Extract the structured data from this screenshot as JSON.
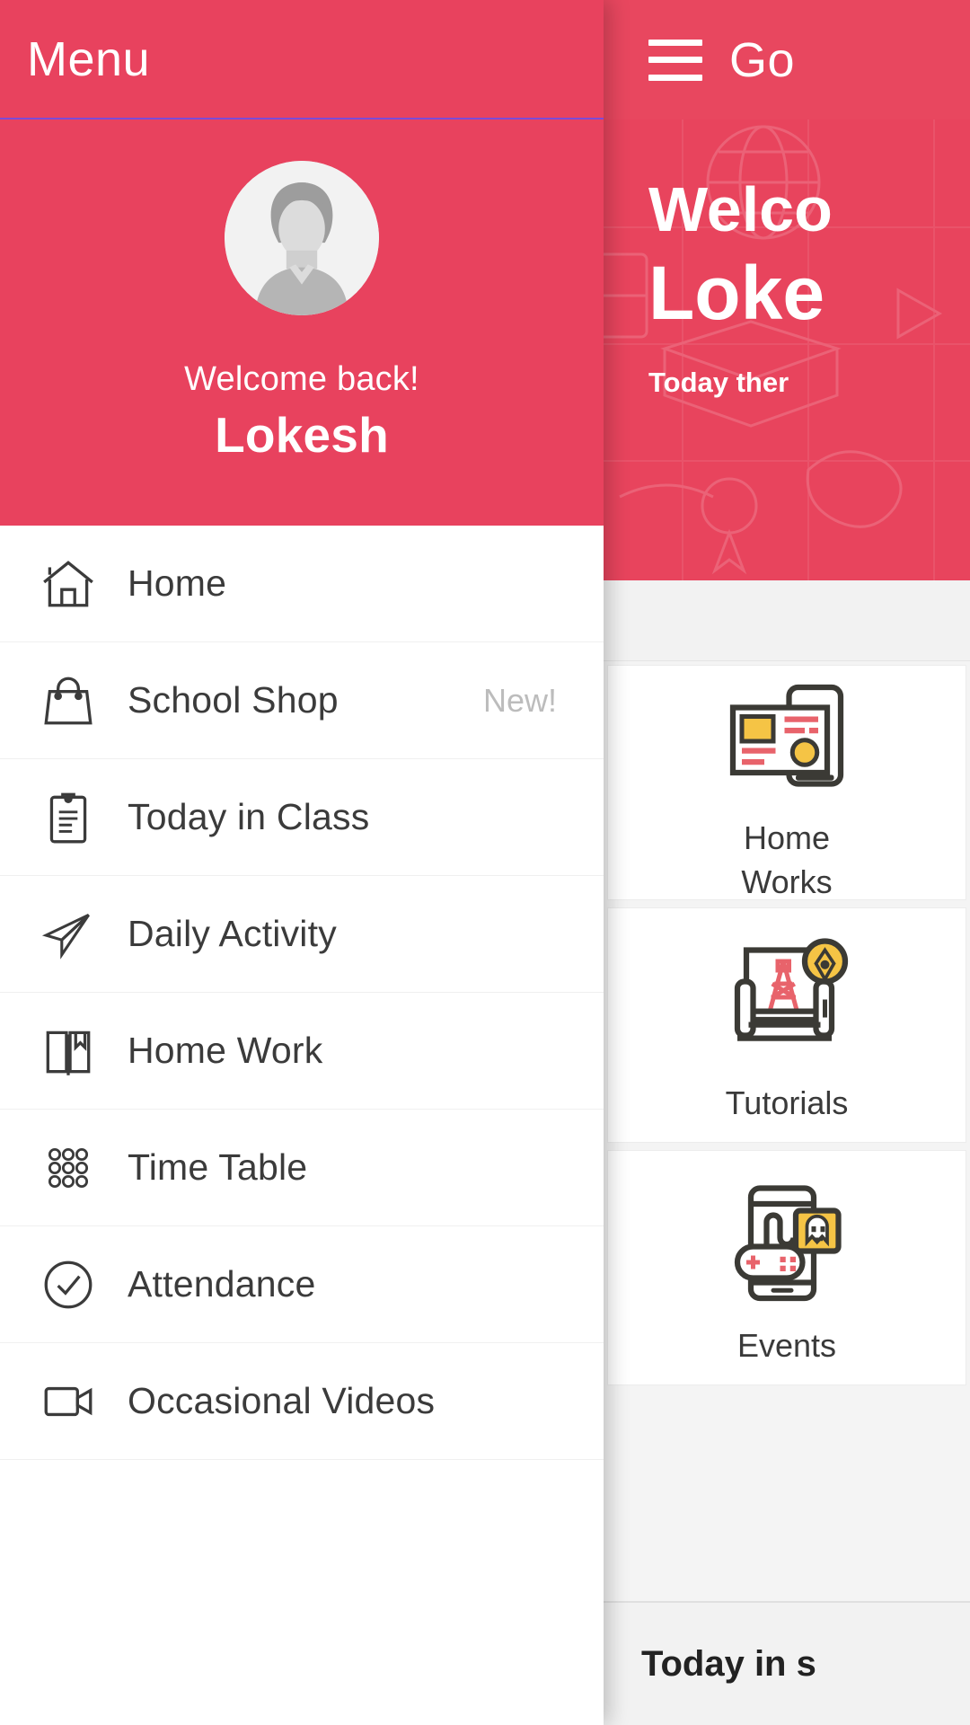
{
  "background_app": {
    "topbar": {
      "menu_icon": "hamburger-icon",
      "title": "Go"
    },
    "hero": {
      "welcome_line": "Welco",
      "name_line": "Loke",
      "subtitle": "Today ther"
    },
    "tiles": [
      {
        "label": "Home Works",
        "icon": "homework-illustration-icon"
      },
      {
        "label": "Tutorials",
        "icon": "tutorials-illustration-icon"
      },
      {
        "label": "Events",
        "icon": "events-gaming-illustration-icon"
      }
    ],
    "section": {
      "title": "Today in s"
    }
  },
  "drawer": {
    "topbar": {
      "title": "Menu"
    },
    "profile": {
      "avatar_icon": "user-avatar-placeholder-icon",
      "greeting": "Welcome back!",
      "name": "Lokesh"
    },
    "menu_items": [
      {
        "label": "Home",
        "icon": "house-icon",
        "badge": ""
      },
      {
        "label": "School Shop",
        "icon": "shopping-bag-icon",
        "badge": "New!"
      },
      {
        "label": "Today in Class",
        "icon": "clipboard-icon",
        "badge": ""
      },
      {
        "label": "Daily Activity",
        "icon": "paper-plane-icon",
        "badge": ""
      },
      {
        "label": "Home Work",
        "icon": "open-book-icon",
        "badge": ""
      },
      {
        "label": "Time Table",
        "icon": "grid-dots-icon",
        "badge": ""
      },
      {
        "label": "Attendance",
        "icon": "check-circle-icon",
        "badge": ""
      },
      {
        "label": "Occasional Videos",
        "icon": "video-camera-icon",
        "badge": ""
      }
    ]
  },
  "colors": {
    "brand_red": "#e8425e",
    "topbar_red": "#e8475f",
    "divider_purple": "#7b4bd8",
    "badge_gray": "#bcbcbc",
    "text_dark": "#3b3b3b",
    "tile_yellow": "#f5c445",
    "tile_red": "#e8636b",
    "tile_outline": "#3b3a35"
  }
}
